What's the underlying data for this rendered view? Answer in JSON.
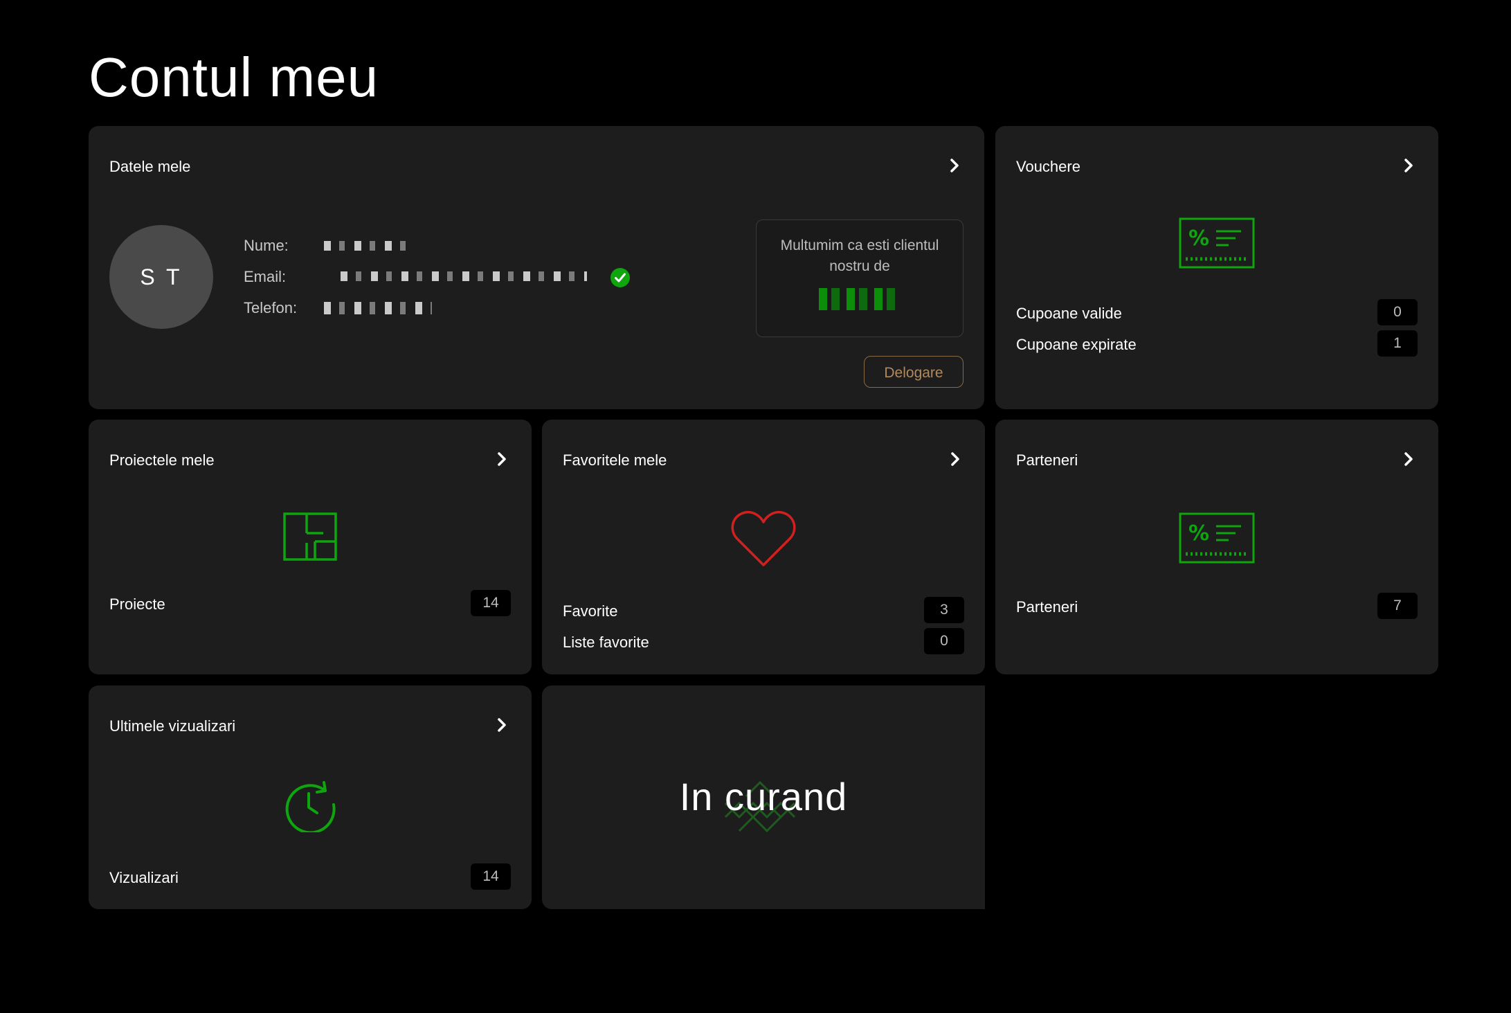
{
  "page": {
    "title": "Contul meu"
  },
  "profile_card": {
    "title": "Datele mele",
    "avatar_initials": "S T",
    "name_label": "Nume:",
    "email_label": "Email:",
    "phone_label": "Telefon:",
    "thanks_message": "Multumim ca esti clientul nostru de",
    "logout_label": "Delogare"
  },
  "vouchers_card": {
    "title": "Vouchere",
    "icon": "voucher-icon",
    "rows": [
      {
        "label": "Cupoane valide",
        "value": "0"
      },
      {
        "label": "Cupoane expirate",
        "value": "1"
      }
    ]
  },
  "projects_card": {
    "title": "Proiectele mele",
    "icon": "floorplan-icon",
    "rows": [
      {
        "label": "Proiecte",
        "value": "14"
      }
    ]
  },
  "favorites_card": {
    "title": "Favoritele mele",
    "icon": "heart-icon",
    "rows": [
      {
        "label": "Favorite",
        "value": "3"
      },
      {
        "label": "Liste favorite",
        "value": "0"
      }
    ]
  },
  "partners_card": {
    "title": "Parteneri",
    "icon": "voucher-icon",
    "rows": [
      {
        "label": "Parteneri",
        "value": "7"
      }
    ]
  },
  "views_card": {
    "title": "Ultimele vizualizari",
    "icon": "history-icon",
    "rows": [
      {
        "label": "Vizualizari",
        "value": "14"
      }
    ]
  },
  "coming_soon_card": {
    "text": "In curand"
  },
  "colors": {
    "background": "#000000",
    "card": "#1d1d1d",
    "accent_green": "#0ea50e",
    "heart_red": "#d02020",
    "logout_border": "#8a6a45"
  }
}
